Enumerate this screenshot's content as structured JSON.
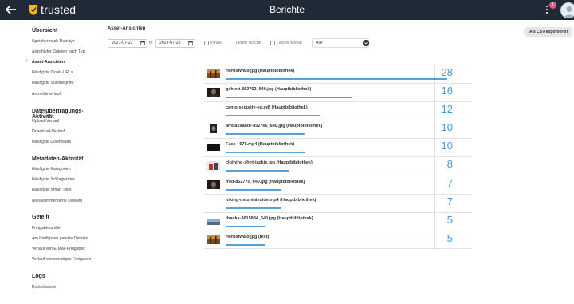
{
  "app": {
    "brand": "trusted",
    "title": "Berichte",
    "notification_count": "1"
  },
  "sidebar": {
    "sections": [
      {
        "heading": "Übersicht",
        "items": [
          "Speicher nach Dateityp",
          "Anzahl der Dateien nach Typ",
          "Asset-Ansichten",
          "Häufigste Direkt-URLs",
          "Häufigste Suchbegriffe",
          "Anmeldeverlauf"
        ]
      },
      {
        "heading": "Dateiübertragungs-Aktivität",
        "items": [
          "Upload-Verlauf",
          "Download-Verlauf",
          "Häufigste Downloads"
        ]
      },
      {
        "heading": "Metadaten-Aktivität",
        "items": [
          "Häufigste Kategorien",
          "Häufigste Schlagwörter",
          "Häufigste Smart Tags",
          "Meistkommentierte Dateien"
        ]
      },
      {
        "heading": "Geteilt",
        "items": [
          "Freigabekanäle",
          "Am häufigsten geteilte Dateien",
          "Verlauf von E-Mail-Freigaben",
          "Verlauf von sonstigen Freigaben"
        ]
      },
      {
        "heading": "Logs",
        "items": [
          "Kontohistorie"
        ]
      }
    ],
    "active_item": "Asset-Ansichten"
  },
  "main": {
    "heading": "Asset-Ansichten",
    "export_label": "Als CSV exportieren",
    "filters": {
      "date_from": "2021-07-22",
      "to_label": "to",
      "date_to": "2021-07-26",
      "checkboxes": [
        "Heute",
        "Letzte Woche",
        "Letzter Monat"
      ],
      "select_value": "Alle"
    },
    "assets": [
      {
        "name": "Herbstwald.jpg (Hauptbibliothek)",
        "count": 28,
        "thumb": "autumn"
      },
      {
        "name": "gehlert-852762_640.jpg (Hauptbibliothek)",
        "count": 16,
        "thumb": "portrait-dark"
      },
      {
        "name": "canto-security-en.pdf (Hauptbibliothek)",
        "count": 12,
        "thumb": "none"
      },
      {
        "name": "ambassador-852766_640.jpg (Hauptbibliothek)",
        "count": 10,
        "thumb": "portrait"
      },
      {
        "name": "Face - 678.mp4 (Hauptbibliothek)",
        "count": 10,
        "thumb": "video-dark"
      },
      {
        "name": "clothing-shirt-jackie.jpg (Hauptbibliothek)",
        "count": 8,
        "thumb": "clothing"
      },
      {
        "name": "fred-852770_640.jpg (Hauptbibliothek)",
        "count": 7,
        "thumb": "portrait-dark"
      },
      {
        "name": "hiking-mountainside.mp4 (Hauptbibliothek)",
        "count": 7,
        "thumb": "none"
      },
      {
        "name": "thanks-3615884_640.jpg (Hauptbibliothek)",
        "count": 5,
        "thumb": "landscape"
      },
      {
        "name": "Herbstwald.jpg (test)",
        "count": 5,
        "thumb": "autumn"
      }
    ]
  },
  "colors": {
    "topbar": "#1f2a36",
    "accent": "#4a9ad6",
    "bar": "#5aa0d8",
    "logo": "#f5b914",
    "badge": "#e35b7a"
  }
}
